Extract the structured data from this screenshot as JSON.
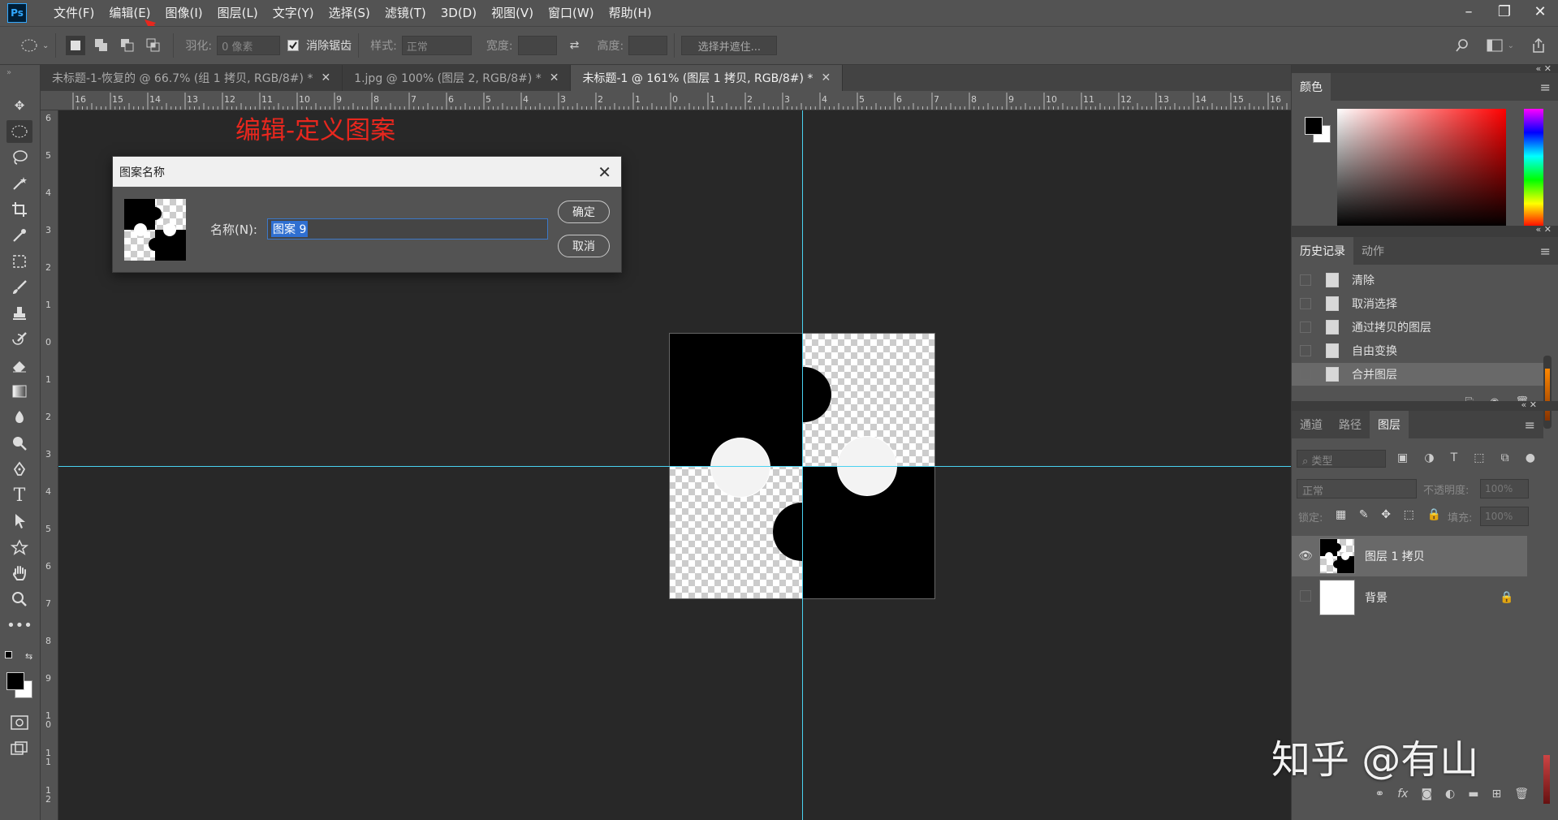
{
  "app": {
    "logo": "Ps"
  },
  "menubar": {
    "items": [
      "文件(F)",
      "编辑(E)",
      "图像(I)",
      "图层(L)",
      "文字(Y)",
      "选择(S)",
      "滤镜(T)",
      "3D(D)",
      "视图(V)",
      "窗口(W)",
      "帮助(H)"
    ],
    "window_controls": [
      "minimize-icon",
      "restore-icon",
      "close-icon"
    ]
  },
  "options": {
    "feather_label": "羽化:",
    "feather_value": "0 像素",
    "antialias_label": "消除锯齿",
    "antialias_checked": true,
    "style_label": "样式:",
    "style_value": "正常",
    "width_label": "宽度:",
    "height_label": "高度:",
    "select_mask_button": "选择并遮住..."
  },
  "doc_tabs": [
    {
      "label": "未标题-1-恢复的 @ 66.7% (组 1 拷贝, RGB/8#) *",
      "active": false
    },
    {
      "label": "1.jpg @ 100% (图层 2, RGB/8#) *",
      "active": false
    },
    {
      "label": "未标题-1 @ 161% (图层 1 拷贝, RGB/8#) *",
      "active": true
    }
  ],
  "ruler_top": [
    "16",
    "15",
    "14",
    "13",
    "12",
    "11",
    "10",
    "9",
    "8",
    "7",
    "6",
    "5",
    "4",
    "3",
    "2",
    "1",
    "0",
    "1",
    "2",
    "3",
    "4",
    "5",
    "6",
    "7",
    "8",
    "9",
    "10",
    "11",
    "12",
    "13",
    "14",
    "15",
    "16"
  ],
  "ruler_left": [
    "6",
    "5",
    "4",
    "3",
    "2",
    "1",
    "0",
    "1",
    "2",
    "3",
    "4",
    "5",
    "6",
    "7",
    "8",
    "9",
    "1 0",
    "1 1",
    "1 2"
  ],
  "annotation": "编辑-定义图案",
  "dialog": {
    "title": "图案名称",
    "name_label": "名称(N):",
    "name_value": "图案 9",
    "ok_button": "确定",
    "cancel_button": "取消"
  },
  "color_panel": {
    "tab": "颜色",
    "accent_hue": "#ff0000"
  },
  "history_panel": {
    "tabs": [
      "历史记录",
      "动作"
    ],
    "items": [
      "清除",
      "取消选择",
      "通过拷贝的图层",
      "自由变换",
      "合并图层"
    ]
  },
  "layers_panel": {
    "tabs": [
      "通道",
      "路径",
      "图层"
    ],
    "filter_placeholder": "类型",
    "blend_mode": "正常",
    "opacity_label": "不透明度:",
    "opacity_value": "100%",
    "lock_label": "锁定:",
    "fill_label": "填充:",
    "fill_value": "100%",
    "layers": [
      {
        "name": "图层 1 拷贝",
        "visible": true,
        "selected": true
      },
      {
        "name": "背景",
        "visible": false,
        "locked": true
      }
    ]
  },
  "watermark": "知乎 @有山"
}
